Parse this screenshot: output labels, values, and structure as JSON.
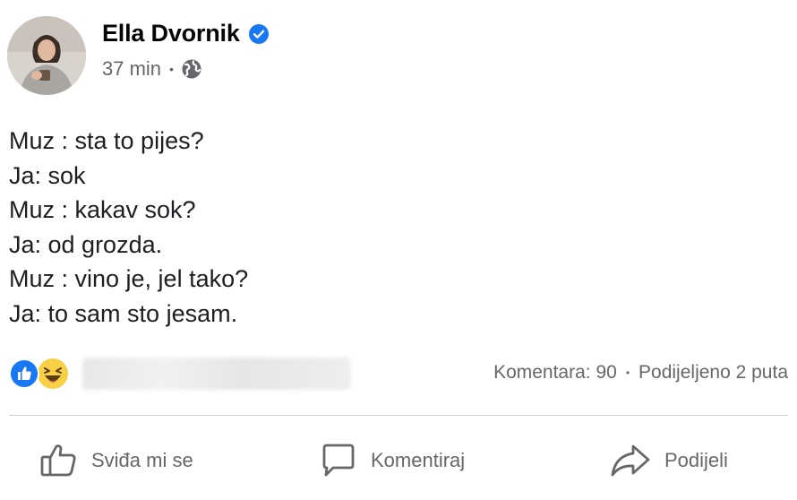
{
  "author": {
    "name": "Ella Dvornik",
    "verified": true,
    "time": "37 min",
    "separator": "•",
    "audience_icon": "globe-icon"
  },
  "post": {
    "lines": [
      "Muz : sta to pijes?",
      "Ja: sok",
      "Muz : kakav sok?",
      "Ja: od grozda.",
      "Muz : vino je, jel tako?",
      "Ja: to sam sto jesam."
    ]
  },
  "stats": {
    "reaction_icons": [
      "like-icon",
      "haha-icon"
    ],
    "comments": "Komentara: 90",
    "separator": "•",
    "shares": "Podijeljeno 2 puta"
  },
  "actions": {
    "like_label": "Sviđa mi se",
    "comment_label": "Komentiraj",
    "share_label": "Podijeli"
  },
  "colors": {
    "verified_blue": "#1877f2",
    "secondary_text": "#65676b",
    "like_blue": "#1877f2",
    "haha_yellow": "#f7d046"
  }
}
